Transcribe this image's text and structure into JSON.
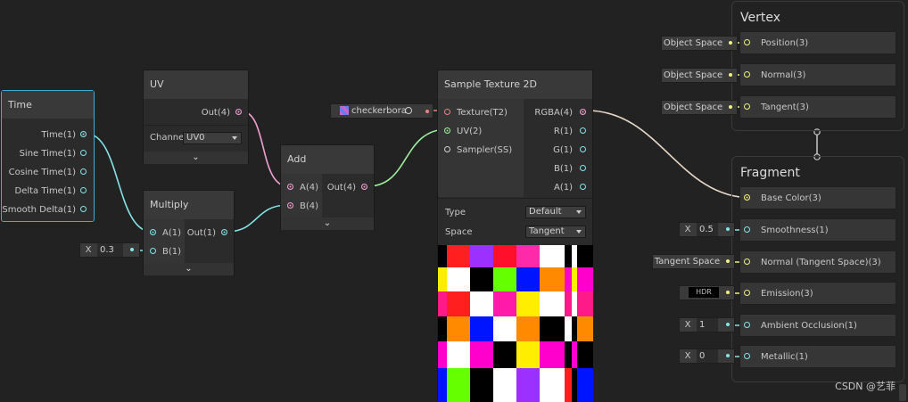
{
  "nodes": {
    "time": {
      "title": "Time",
      "outputs": [
        "Time(1)",
        "Sine Time(1)",
        "Cosine Time(1)",
        "Delta Time(1)",
        "Smooth Delta(1)"
      ]
    },
    "uv": {
      "title": "UV",
      "output": "Out(4)",
      "channel_label": "Channe",
      "channel_value": "UV0"
    },
    "multiply": {
      "title": "Multiply",
      "inputs": [
        "A(1)",
        "B(1)"
      ],
      "output": "Out(1)",
      "b_inline": {
        "axis": "X",
        "value": "0.3"
      }
    },
    "add": {
      "title": "Add",
      "inputs": [
        "A(4)",
        "B(4)"
      ],
      "output": "Out(4)"
    },
    "sample_texture": {
      "title": "Sample Texture 2D",
      "inputs": [
        "Texture(T2)",
        "UV(2)",
        "Sampler(SS)"
      ],
      "outputs": [
        "RGBA(4)",
        "R(1)",
        "G(1)",
        "B(1)",
        "A(1)"
      ],
      "texture_inline": "checkerbora",
      "type_label": "Type",
      "type_value": "Default",
      "space_label": "Space",
      "space_value": "Tangent"
    }
  },
  "master": {
    "vertex": {
      "header": "Vertex",
      "blocks": [
        {
          "label": "Position(3)",
          "inline": "Object Space"
        },
        {
          "label": "Normal(3)",
          "inline": "Object Space"
        },
        {
          "label": "Tangent(3)",
          "inline": "Object Space"
        }
      ]
    },
    "fragment": {
      "header": "Fragment",
      "blocks": [
        {
          "label": "Base Color(3)"
        },
        {
          "label": "Smoothness(1)",
          "inline_axis": "X",
          "inline_value": "0.5"
        },
        {
          "label": "Normal (Tangent Space)(3)",
          "inline": "Tangent Space"
        },
        {
          "label": "Emission(3)",
          "inline": "HDR"
        },
        {
          "label": "Ambient Occlusion(1)",
          "inline_axis": "X",
          "inline_value": "1"
        },
        {
          "label": "Metallic(1)",
          "inline_axis": "X",
          "inline_value": "0"
        }
      ]
    }
  },
  "watermark": "CSDN @艺菲",
  "colors": {
    "background": "#222222",
    "float_port": "#84e4e7",
    "vector4_port": "#f0a0d0",
    "vector2_port": "#9ef09e",
    "vector3_port": "#f0f080",
    "texture_port": "#f08080",
    "selection": "#44a8d8"
  }
}
